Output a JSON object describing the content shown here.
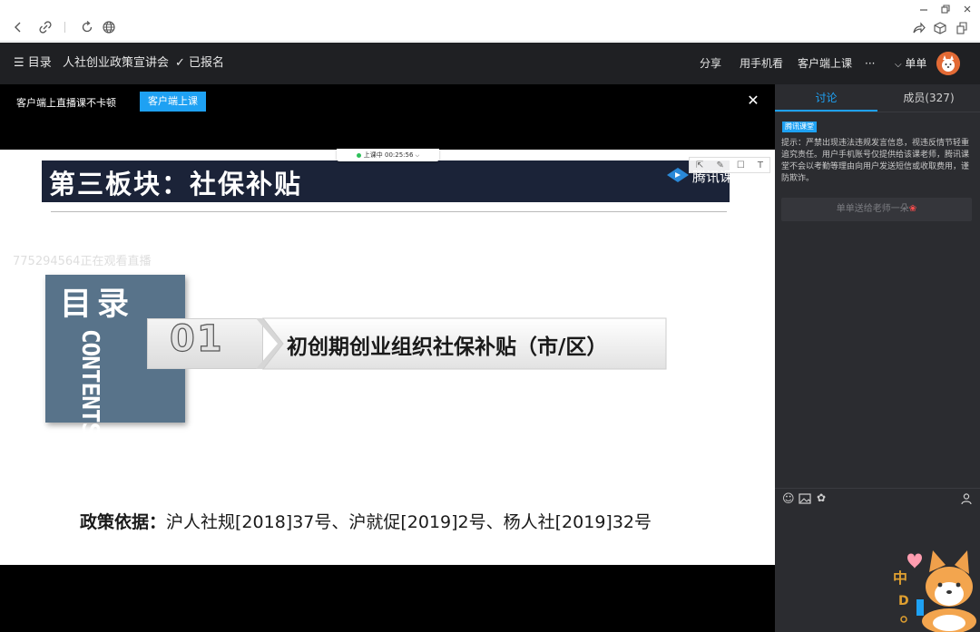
{
  "window": {
    "minimize_icon": "minimize-icon",
    "restore_icon": "restore-icon",
    "close_icon": "close-icon"
  },
  "browser": {
    "back_icon": "back-arrow-icon",
    "link_icon": "link-icon",
    "refresh_icon": "refresh-icon",
    "globe_icon": "globe-icon",
    "share_icon": "share-icon",
    "box_icon": "box-icon",
    "copy_icon": "copy-icon"
  },
  "header": {
    "menu_label": "☰ 目录",
    "course_title": "人社创业政策宣讲会",
    "enrolled": "✓ 已报名",
    "share": "分享",
    "mobile": "用手机看",
    "client": "客户端上课",
    "more": "···",
    "user": "单单"
  },
  "banner": {
    "text": "客户端上直播课不卡顿",
    "button": "客户端上课",
    "close": "✕"
  },
  "status": {
    "live_time": "上课中 00:25:56"
  },
  "slide": {
    "section_title": "第三板块：社保补贴",
    "logo_text": "腾讯课堂",
    "watermark": "775294564正在观看直播",
    "toc_cn": "目录",
    "toc_en": "CONTENTS",
    "item_number": "01",
    "item_title": "初创期创业组织社保补贴（市/区）",
    "policy_label": "政策依据：",
    "policy_text": "沪人社规[2018]37号、沪就促[2019]2号、杨人社[2019]32号"
  },
  "panel": {
    "tab_discuss": "讨论",
    "tab_members": "成员(327)",
    "badge": "腾讯课堂",
    "notice": "提示：严禁出现违法违规发言信息，视违反情节轻重追究责任。用户手机账号仅提供给该课老师，腾讯课堂不会以考勤等理由向用户发送短信或收取费用，谨防欺诈。",
    "flower": "单单送给老师一朵",
    "emoji_icon": "emoji-icon",
    "image_icon": "image-icon",
    "flower_icon": "flower-icon",
    "user_icon": "user-icon"
  },
  "colors": {
    "accent": "#1ea1f3",
    "header_bg": "#1f2023",
    "panel_bg": "#2b2c30",
    "slide_navy": "#1b2338",
    "toc_box": "#58738a"
  }
}
